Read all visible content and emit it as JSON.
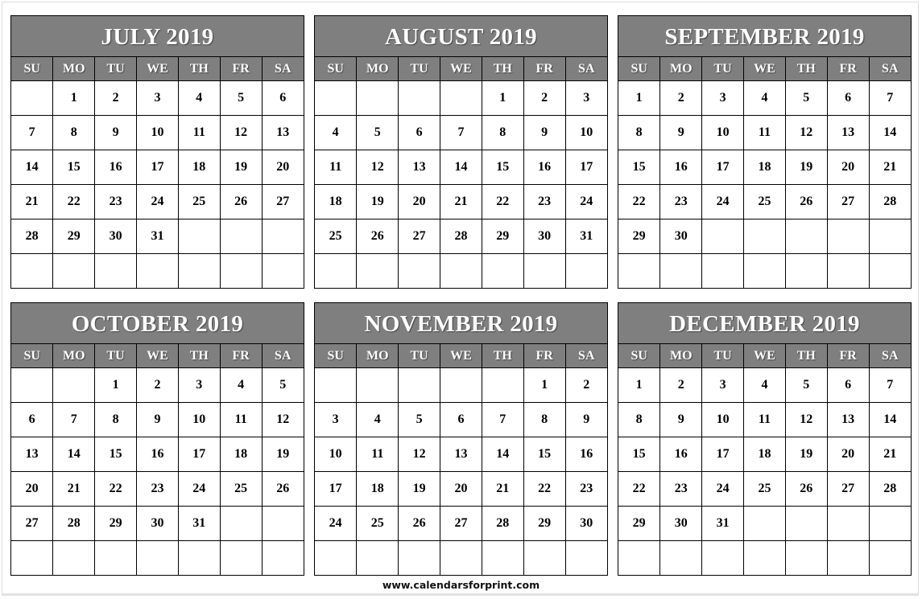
{
  "weekdays": [
    "SU",
    "MO",
    "TU",
    "WE",
    "TH",
    "FR",
    "SA"
  ],
  "months": [
    {
      "title": "JULY 2019",
      "weeks": [
        [
          "",
          "1",
          "2",
          "3",
          "4",
          "5",
          "6"
        ],
        [
          "7",
          "8",
          "9",
          "10",
          "11",
          "12",
          "13"
        ],
        [
          "14",
          "15",
          "16",
          "17",
          "18",
          "19",
          "20"
        ],
        [
          "21",
          "22",
          "23",
          "24",
          "25",
          "26",
          "27"
        ],
        [
          "28",
          "29",
          "30",
          "31",
          "",
          "",
          ""
        ],
        [
          "",
          "",
          "",
          "",
          "",
          "",
          ""
        ]
      ]
    },
    {
      "title": "AUGUST 2019",
      "weeks": [
        [
          "",
          "",
          "",
          "",
          "1",
          "2",
          "3"
        ],
        [
          "4",
          "5",
          "6",
          "7",
          "8",
          "9",
          "10"
        ],
        [
          "11",
          "12",
          "13",
          "14",
          "15",
          "16",
          "17"
        ],
        [
          "18",
          "19",
          "20",
          "21",
          "22",
          "23",
          "24"
        ],
        [
          "25",
          "26",
          "27",
          "28",
          "29",
          "30",
          "31"
        ],
        [
          "",
          "",
          "",
          "",
          "",
          "",
          ""
        ]
      ]
    },
    {
      "title": "SEPTEMBER 2019",
      "weeks": [
        [
          "1",
          "2",
          "3",
          "4",
          "5",
          "6",
          "7"
        ],
        [
          "8",
          "9",
          "10",
          "11",
          "12",
          "13",
          "14"
        ],
        [
          "15",
          "16",
          "17",
          "18",
          "19",
          "20",
          "21"
        ],
        [
          "22",
          "23",
          "24",
          "25",
          "26",
          "27",
          "28"
        ],
        [
          "29",
          "30",
          "",
          "",
          "",
          "",
          ""
        ],
        [
          "",
          "",
          "",
          "",
          "",
          "",
          ""
        ]
      ]
    },
    {
      "title": "OCTOBER 2019",
      "weeks": [
        [
          "",
          "",
          "1",
          "2",
          "3",
          "4",
          "5"
        ],
        [
          "6",
          "7",
          "8",
          "9",
          "10",
          "11",
          "12"
        ],
        [
          "13",
          "14",
          "15",
          "16",
          "17",
          "18",
          "19"
        ],
        [
          "20",
          "21",
          "22",
          "23",
          "24",
          "25",
          "26"
        ],
        [
          "27",
          "28",
          "29",
          "30",
          "31",
          "",
          ""
        ],
        [
          "",
          "",
          "",
          "",
          "",
          "",
          ""
        ]
      ]
    },
    {
      "title": "NOVEMBER 2019",
      "weeks": [
        [
          "",
          "",
          "",
          "",
          "",
          "1",
          "2"
        ],
        [
          "3",
          "4",
          "5",
          "6",
          "7",
          "8",
          "9"
        ],
        [
          "10",
          "11",
          "12",
          "13",
          "14",
          "15",
          "16"
        ],
        [
          "17",
          "18",
          "19",
          "20",
          "21",
          "22",
          "23"
        ],
        [
          "24",
          "25",
          "26",
          "27",
          "28",
          "29",
          "30"
        ],
        [
          "",
          "",
          "",
          "",
          "",
          "",
          ""
        ]
      ]
    },
    {
      "title": "DECEMBER 2019",
      "weeks": [
        [
          "1",
          "2",
          "3",
          "4",
          "5",
          "6",
          "7"
        ],
        [
          "8",
          "9",
          "10",
          "11",
          "12",
          "13",
          "14"
        ],
        [
          "15",
          "16",
          "17",
          "18",
          "19",
          "20",
          "21"
        ],
        [
          "22",
          "23",
          "24",
          "25",
          "26",
          "27",
          "28"
        ],
        [
          "29",
          "30",
          "31",
          "",
          "",
          "",
          ""
        ],
        [
          "",
          "",
          "",
          "",
          "",
          "",
          ""
        ]
      ]
    }
  ],
  "footer": {
    "website": "www.calendarsforprint.com"
  }
}
